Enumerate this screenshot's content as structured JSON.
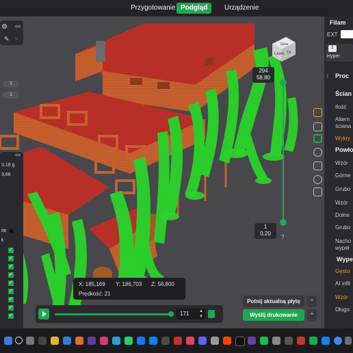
{
  "topbar": {
    "tabs": [
      {
        "label": "Przygotowanie",
        "active": false
      },
      {
        "label": "Podgląd",
        "active": true
      },
      {
        "label": "Urządzenie",
        "active": false
      }
    ]
  },
  "view_cube": {
    "face_top": "Góra",
    "face_left": "Lewo",
    "face_right": "Tył"
  },
  "layer_slider": {
    "top_layer": "294",
    "top_height": "58,80",
    "bottom_layer": "1",
    "bottom_height": "0,20",
    "help": "?"
  },
  "info": {
    "x_label": "X: 185,169",
    "y_label": "Y: 186,703",
    "z_label": "Z: 58,800",
    "speed_label": "Prędkość: 21"
  },
  "playback": {
    "progress": 0.98,
    "layer_value": "171"
  },
  "buttons": {
    "slice_plate": "Potnij aktualną płytę",
    "print": "Wyślij drukowanie",
    "expand_arrow": "^"
  },
  "left_panel": {
    "collapse": "<<",
    "badge_1": "1",
    "badge_2": "1",
    "collapse_2": "<<",
    "val_1": "3,16 g",
    "val_2": "3,66",
    "label_ite": "ite",
    "label_t": "t",
    "checks": [
      "✓",
      "✓",
      "✓",
      "✓",
      "✓",
      "✓",
      "✓",
      "✓",
      "✓"
    ]
  },
  "right_panel": {
    "filament": "Filam",
    "ext": "EXT",
    "hyper_num": "1",
    "hyper": "Hyper",
    "process": "Proc",
    "sections": [
      {
        "head": "Ścian"
      },
      {
        "item": "Ilość"
      },
      {
        "item": "Altern"
      },
      {
        "item": "ściana"
      },
      {
        "item": "Wykry",
        "orange": true
      },
      {
        "head": "Powło"
      },
      {
        "item": "Wzór"
      },
      {
        "item": "Górne"
      },
      {
        "item": "Grubo"
      },
      {
        "item": "Wzór"
      },
      {
        "item": "Dolne"
      },
      {
        "item": "Grubo"
      },
      {
        "item": "Nacho"
      },
      {
        "item": "wypeł"
      },
      {
        "head": "Wype"
      },
      {
        "item": "Gęsto",
        "orange": true
      },
      {
        "item": "AI infil"
      },
      {
        "item": "Wzór",
        "orange": true
      },
      {
        "item": "Długo"
      }
    ]
  },
  "colors": {
    "accent": "#1fa853",
    "model": "#c8602e",
    "model_top": "#b22a24",
    "support": "#2ed42e",
    "orange": "#e69b2e"
  }
}
